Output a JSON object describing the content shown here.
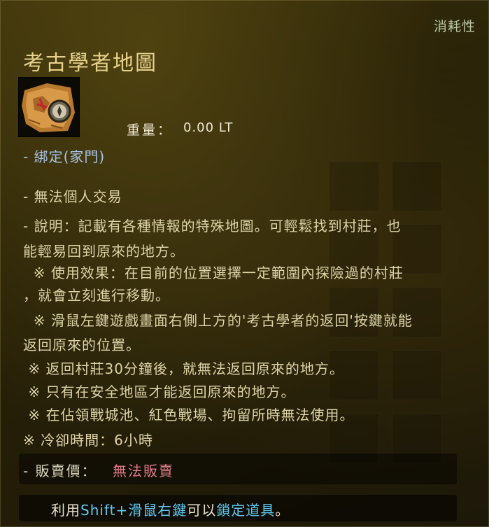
{
  "tooltip": {
    "category": "消耗性",
    "title": "考古學者地圖",
    "weight_label": "重量：",
    "weight_value": "0.00 LT",
    "bound": "- 綁定(家門)",
    "no_trade": "- 無法個人交易",
    "description": [
      "- 說明：記載有各種情報的特殊地圖。可輕鬆找到村莊，也",
      "能輕易回到原來的地方。",
      "  ※ 使用效果：在目前的位置選擇一定範圍內探險過的村莊",
      "，就會立刻進行移動。",
      "  ※ 滑鼠左鍵遊戲畫面右側上方的'考古學者的返回'按鍵就能",
      "返回原來的位置。",
      " ※ 返回村莊30分鐘後，就無法返回原來的地方。",
      " ※ 只有在安全地區才能返回原來的地方。",
      " ※ 在佔領戰城池、紅色戰場、拘留所時無法使用。",
      "※ 冷卻時間：6小時"
    ],
    "sell_label": "- 販賣價：",
    "sell_value": "無法販賣",
    "hint": {
      "prefix": "利用",
      "key1": "Shift+滑鼠右鍵",
      "middle": "可以",
      "key2": "鎖定道具",
      "suffix": "。"
    }
  },
  "icon": "treasure-map-icon",
  "colors": {
    "title": "#e6d08a",
    "bound": "#a8c4e8",
    "sell_value": "#e07a8a",
    "hint_key": "#5fc8f0"
  }
}
